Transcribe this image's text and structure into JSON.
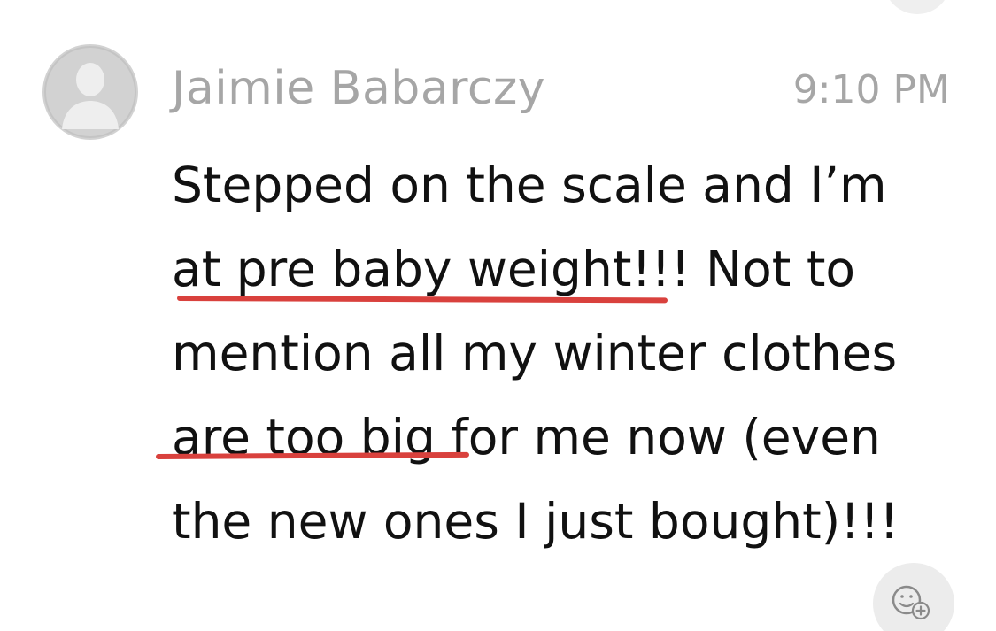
{
  "message": {
    "sender_name": "Jaimie Babarczy",
    "timestamp": "9:10 PM",
    "text_lines": [
      "Stepped on the scale and I’m",
      "at pre baby weight!!!  Not to",
      "mention all my winter clothes",
      "are too big for me now (even",
      "the new ones I just bought)!!!"
    ],
    "underlined_phrases": [
      "at pre baby weight",
      "are too big"
    ]
  },
  "colors": {
    "underline": "#d9413d",
    "meta_text": "#a6a6a6",
    "body_text": "#111111",
    "avatar_bg": "#d2d2d2"
  },
  "icons": {
    "avatar": "default-user-avatar-icon",
    "reaction": "add-reaction-icon"
  }
}
